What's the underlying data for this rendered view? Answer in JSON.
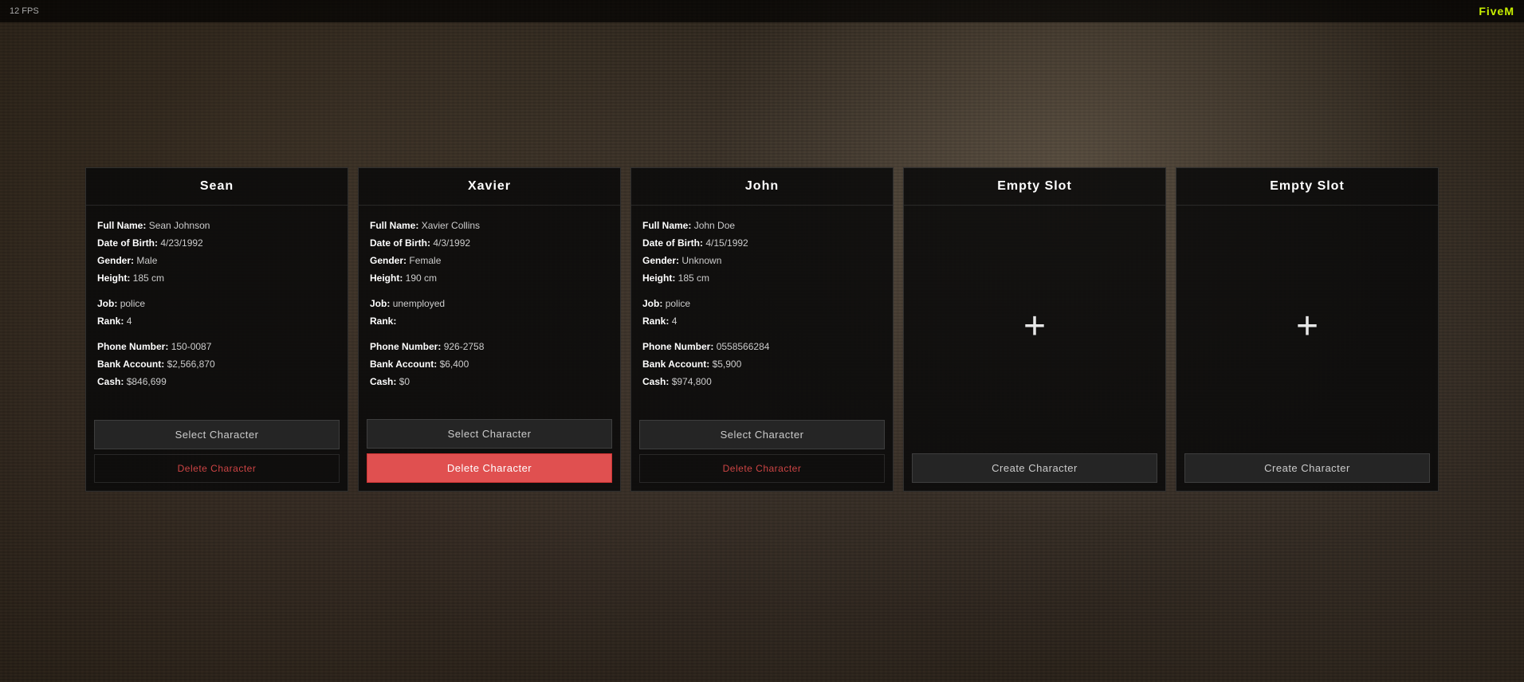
{
  "topbar": {
    "fps": "12 FPS",
    "logo": "FiveM"
  },
  "characters": [
    {
      "name": "Sean",
      "full_name": "Sean Johnson",
      "dob": "4/23/1992",
      "gender": "Male",
      "height": "185 cm",
      "job": "police",
      "rank": "4",
      "phone": "150-0087",
      "bank": "$2,566,870",
      "cash": "$846,699",
      "select_label": "Select Character",
      "delete_label": "Delete Character",
      "delete_active": false
    },
    {
      "name": "Xavier",
      "full_name": "Xavier Collins",
      "dob": "4/3/1992",
      "gender": "Female",
      "height": "190 cm",
      "job": "unemployed",
      "rank": "",
      "phone": "926-2758",
      "bank": "$6,400",
      "cash": "$0",
      "select_label": "Select Character",
      "delete_label": "Delete Character",
      "delete_active": true
    },
    {
      "name": "John",
      "full_name": "John Doe",
      "dob": "4/15/1992",
      "gender": "Unknown",
      "height": "185 cm",
      "job": "police",
      "rank": "4",
      "phone": "0558566284",
      "bank": "$5,900",
      "cash": "$974,800",
      "select_label": "Select Character",
      "delete_label": "Delete Character",
      "delete_active": false
    }
  ],
  "empty_slots": [
    {
      "title": "Empty Slot",
      "create_label": "Create Character"
    },
    {
      "title": "Empty Slot",
      "create_label": "Create Character"
    }
  ],
  "labels": {
    "full_name": "Full Name:",
    "dob": "Date of Birth:",
    "gender": "Gender:",
    "height": "Height:",
    "job": "Job:",
    "rank": "Rank:",
    "phone": "Phone Number:",
    "bank": "Bank Account:",
    "cash": "Cash:"
  }
}
